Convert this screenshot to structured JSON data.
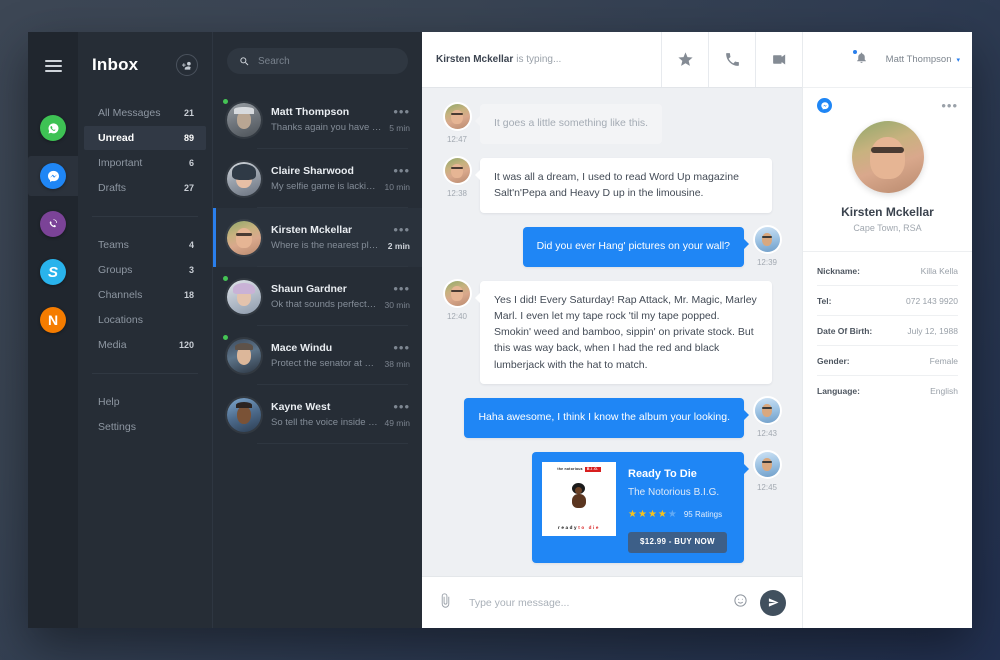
{
  "rail": {
    "menu_icon": "hamburger-icon",
    "apps": [
      {
        "name": "whatsapp",
        "glyph": "✆",
        "color": "#3ec254",
        "active": false
      },
      {
        "name": "messenger",
        "glyph": "⚡",
        "color": "#1f86f5",
        "active": true
      },
      {
        "name": "viber",
        "glyph": "✆",
        "color": "#7b4397",
        "active": false
      },
      {
        "name": "skype",
        "glyph": "S",
        "color": "#29b3ec",
        "active": false
      },
      {
        "name": "nimbuzz",
        "glyph": "N",
        "color": "#f57c00",
        "active": false
      }
    ]
  },
  "nav": {
    "title": "Inbox",
    "add_contact_icon": "add-user-icon",
    "primary": [
      {
        "label": "All Messages",
        "count": "21",
        "active": false
      },
      {
        "label": "Unread",
        "count": "89",
        "active": true
      },
      {
        "label": "Important",
        "count": "6",
        "active": false
      },
      {
        "label": "Drafts",
        "count": "27",
        "active": false
      }
    ],
    "secondary": [
      {
        "label": "Teams",
        "count": "4"
      },
      {
        "label": "Groups",
        "count": "3"
      },
      {
        "label": "Channels",
        "count": "18"
      },
      {
        "label": "Locations",
        "count": ""
      },
      {
        "label": "Media",
        "count": "120"
      }
    ],
    "tertiary": [
      {
        "label": "Help",
        "count": ""
      },
      {
        "label": "Settings",
        "count": ""
      }
    ]
  },
  "search": {
    "placeholder": "Search",
    "value": "",
    "icon": "search-icon"
  },
  "conversations": [
    {
      "name": "Matt Thompson",
      "preview": "Thanks again you have been...",
      "time": "5 min",
      "online": true,
      "selected": false,
      "avatar": "ph-matt"
    },
    {
      "name": "Claire Sharwood",
      "preview": "My selfie game is lacking can...",
      "time": "10 min",
      "online": false,
      "selected": false,
      "avatar": "ph-claire"
    },
    {
      "name": "Kirsten Mckellar",
      "preview": "Where is the nearest place to...",
      "time": "2 min",
      "online": false,
      "selected": true,
      "avatar": "ph-kirsten"
    },
    {
      "name": "Shaun Gardner",
      "preview": "Ok that sounds perfect 👍",
      "time": "30 min",
      "online": true,
      "selected": false,
      "avatar": "ph-shaun"
    },
    {
      "name": "Mace Windu",
      "preview": "Protect the senator at all costs.",
      "time": "38 min",
      "online": true,
      "selected": false,
      "avatar": "ph-mace"
    },
    {
      "name": "Kayne West",
      "preview": "So tell the voice inside your...",
      "time": "49 min",
      "online": false,
      "selected": false,
      "avatar": "ph-kanye"
    }
  ],
  "chat_header": {
    "typing_name": "Kirsten Mckellar",
    "typing_text": "is typing...",
    "actions": [
      {
        "name": "favorite-star-icon"
      },
      {
        "name": "phone-call-icon"
      },
      {
        "name": "video-call-icon"
      }
    ]
  },
  "topbar": {
    "bell_icon": "notification-bell-icon",
    "has_notification": true,
    "user_name": "Matt Thompson",
    "caret": "▾"
  },
  "messages": [
    {
      "dir": "in",
      "time": "12:47",
      "ghost": true,
      "text": "It goes a little something like this."
    },
    {
      "dir": "in",
      "time": "12:38",
      "ghost": false,
      "text": "It was all a dream, I used to read Word Up magazine Salt'n'Pepa and Heavy D up in the limousine."
    },
    {
      "dir": "out",
      "time": "12:39",
      "ghost": false,
      "text": "Did you ever Hang' pictures on your wall?"
    },
    {
      "dir": "in",
      "time": "12:40",
      "ghost": false,
      "text": "Yes I did! Every Saturday! Rap Attack, Mr. Magic, Marley Marl. I even let my tape rock 'til my tape popped. Smokin' weed and bamboo, sippin' on private stock.  But this was way back, when I had the red and black lumberjack with the hat to match."
    },
    {
      "dir": "out",
      "time": "12:43",
      "ghost": false,
      "text": "Haha awesome,  I think I know the album your looking."
    }
  ],
  "album_card": {
    "time": "12:45",
    "cover_top_small": "the notorious",
    "cover_top_big": "B.I.G.",
    "cover_bottom_ready": "ready",
    "cover_bottom_todie": "to die",
    "title": "Ready To Die",
    "artist": "The Notorious B.I.G.",
    "stars_filled": 4,
    "stars_total": 5,
    "ratings": "95 Ratings",
    "buy_label": "$12.99  -  BUY NOW",
    "accent": "#1f86f5"
  },
  "composer": {
    "attach_icon": "paperclip-icon",
    "placeholder": "Type your message...",
    "value": "",
    "emoji_icon": "smiley-icon",
    "send_icon": "send-paper-plane-icon"
  },
  "profile": {
    "messenger_badge": "messenger-icon",
    "more_icon": "more-options-icon",
    "name": "Kirsten Mckellar",
    "location": "Cape Town, RSA",
    "fields": [
      {
        "key": "Nickname:",
        "value": "Killa Kella"
      },
      {
        "key": "Tel:",
        "value": "072 143 9920"
      },
      {
        "key": "Date Of Birth:",
        "value": "July 12, 1988"
      },
      {
        "key": "Gender:",
        "value": "Female"
      },
      {
        "key": "Language:",
        "value": "English"
      }
    ]
  }
}
